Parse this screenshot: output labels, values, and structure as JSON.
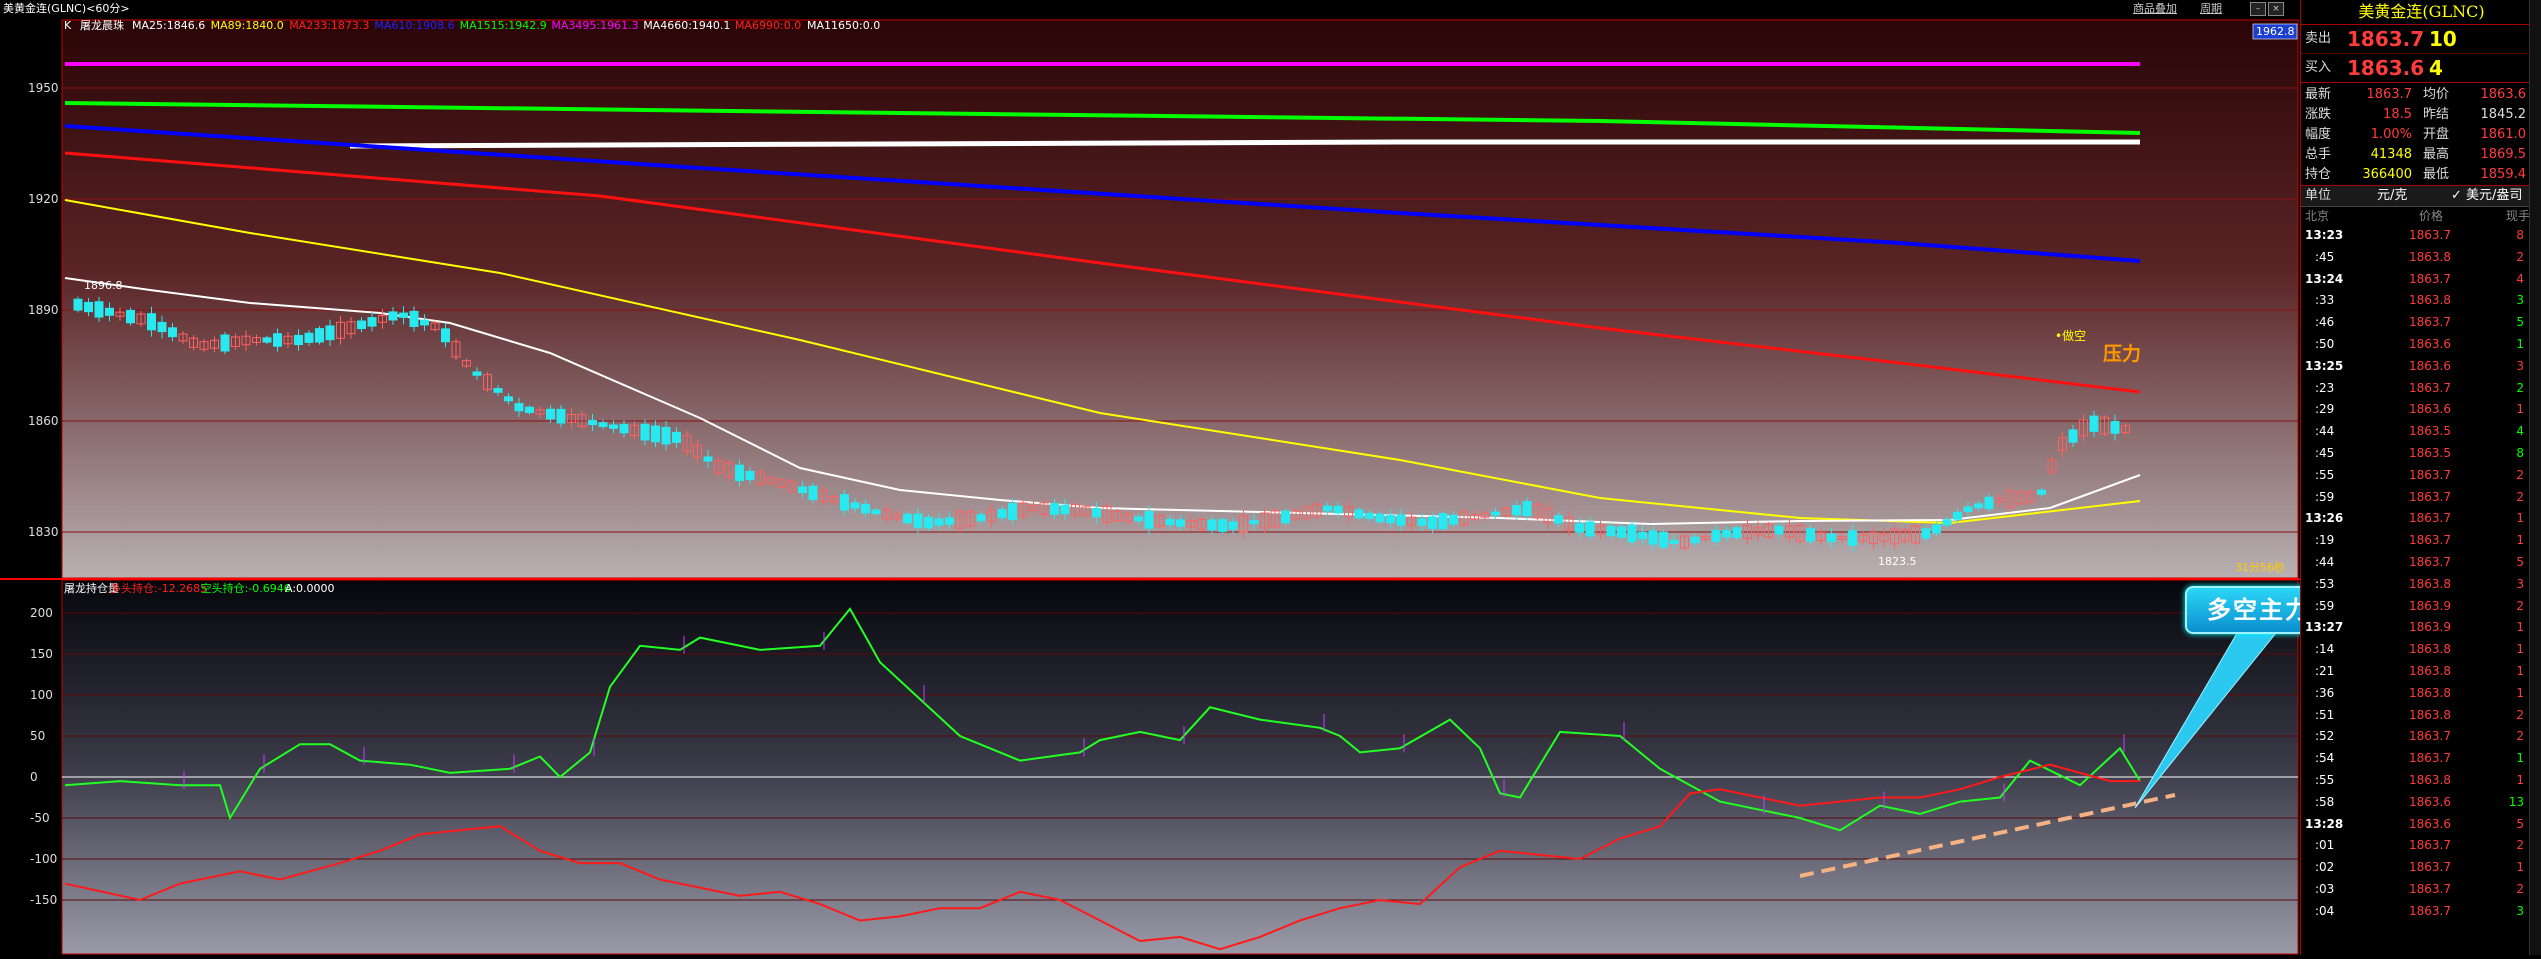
{
  "window": {
    "title": "美黄金连(GLNC)<60分>",
    "menu": [
      "商品叠加",
      "周期"
    ]
  },
  "main_chart": {
    "indicator_label": "K",
    "indicator_name": "屠龙晨珠",
    "ma_legend": [
      {
        "text": "MA25:1846.6",
        "color": "#ffffff"
      },
      {
        "text": "MA89:1840.0",
        "color": "#ffff00"
      },
      {
        "text": "MA233:1873.3",
        "color": "#ff2020"
      },
      {
        "text": "MA610:1908.6",
        "color": "#2222ff"
      },
      {
        "text": "MA1515:1942.9",
        "color": "#00ff00"
      },
      {
        "text": "MA3495:1961.3",
        "color": "#ff00ff"
      },
      {
        "text": "MA4660:1940.1",
        "color": "#ffffff"
      },
      {
        "text": "MA6990:0.0",
        "color": "#ff2020"
      },
      {
        "text": "MA11650:0.0",
        "color": "#ffffff"
      }
    ],
    "price_badge": "1962.8",
    "y_ticks": [
      "1950",
      "1920",
      "1890",
      "1860",
      "1830"
    ],
    "high_label": "1896.8",
    "low_label": "1823.5",
    "annotation_small": "•做空",
    "annotation_pressure": "压力",
    "countdown": "31分56秒"
  },
  "sub_chart": {
    "title": "屠龙持仓量",
    "legend": [
      {
        "text": "多头持仓:-12.2685",
        "color": "#ff2020"
      },
      {
        "text": "空头持仓:-0.6946",
        "color": "#00ff00"
      },
      {
        "text": "A:0.0000",
        "color": "#ffffff"
      }
    ],
    "y_ticks": [
      "200",
      "150",
      "100",
      "50",
      "0",
      "-50",
      "-100",
      "-150"
    ],
    "callout": "多空主力都有增仓动作"
  },
  "panel": {
    "title": "美黄金连(GLNC)",
    "sell": {
      "label": "卖出",
      "price": "1863.7",
      "volume": "10"
    },
    "buy": {
      "label": "买入",
      "price": "1863.6",
      "volume": "4"
    },
    "stats": [
      {
        "l1": "最新",
        "v1": "1863.7",
        "c1": "#ff3c3c",
        "l2": "均价",
        "v2": "1863.6",
        "c2": "#ff3c3c"
      },
      {
        "l1": "涨跌",
        "v1": "18.5",
        "c1": "#ff3c3c",
        "l2": "昨结",
        "v2": "1845.2",
        "c2": "#dddddd"
      },
      {
        "l1": "幅度",
        "v1": "1.00%",
        "c1": "#ff3c3c",
        "l2": "开盘",
        "v2": "1861.0",
        "c2": "#ff3c3c"
      },
      {
        "l1": "总手",
        "v1": "41348",
        "c1": "#ffff00",
        "l2": "最高",
        "v2": "1869.5",
        "c2": "#ff3c3c"
      },
      {
        "l1": "持仓",
        "v1": "366400",
        "c1": "#ffff00",
        "l2": "最低",
        "v2": "1859.4",
        "c2": "#ff3c3c"
      }
    ],
    "unit": {
      "label": "单位",
      "currency": "元/克",
      "usd": "✓ 美元/盎司"
    },
    "header": {
      "time": "北京",
      "price": "价格",
      "vol": "现手"
    },
    "ticks": [
      {
        "t": "13:23",
        "p": "1863.7",
        "v": "8",
        "pc": "#ff3c3c",
        "vc": "#ff3c3c",
        "bold": true
      },
      {
        "t": ":45",
        "p": "1863.8",
        "v": "2",
        "pc": "#ff3c3c",
        "vc": "#ff3c3c"
      },
      {
        "t": "13:24",
        "p": "1863.7",
        "v": "4",
        "pc": "#ff3c3c",
        "vc": "#ff3c3c",
        "bold": true
      },
      {
        "t": ":33",
        "p": "1863.8",
        "v": "3",
        "pc": "#ff3c3c",
        "vc": "#00ff00"
      },
      {
        "t": ":46",
        "p": "1863.7",
        "v": "5",
        "pc": "#ff3c3c",
        "vc": "#00ff00"
      },
      {
        "t": ":50",
        "p": "1863.6",
        "v": "1",
        "pc": "#ff3c3c",
        "vc": "#00ff00"
      },
      {
        "t": "13:25",
        "p": "1863.6",
        "v": "3",
        "pc": "#ff3c3c",
        "vc": "#ff3c3c",
        "bold": true
      },
      {
        "t": ":23",
        "p": "1863.7",
        "v": "2",
        "pc": "#ff3c3c",
        "vc": "#00ff00"
      },
      {
        "t": ":29",
        "p": "1863.6",
        "v": "1",
        "pc": "#ff3c3c",
        "vc": "#ff3c3c"
      },
      {
        "t": ":44",
        "p": "1863.5",
        "v": "4",
        "pc": "#ff3c3c",
        "vc": "#00ff00"
      },
      {
        "t": ":45",
        "p": "1863.5",
        "v": "8",
        "pc": "#ff3c3c",
        "vc": "#00ff00"
      },
      {
        "t": ":55",
        "p": "1863.7",
        "v": "2",
        "pc": "#ff3c3c",
        "vc": "#ff3c3c"
      },
      {
        "t": ":59",
        "p": "1863.7",
        "v": "2",
        "pc": "#ff3c3c",
        "vc": "#ff3c3c"
      },
      {
        "t": "13:26",
        "p": "1863.7",
        "v": "1",
        "pc": "#ff3c3c",
        "vc": "#ff3c3c",
        "bold": true
      },
      {
        "t": ":19",
        "p": "1863.7",
        "v": "1",
        "pc": "#ff3c3c",
        "vc": "#ff3c3c"
      },
      {
        "t": ":44",
        "p": "1863.7",
        "v": "5",
        "pc": "#ff3c3c",
        "vc": "#ff3c3c"
      },
      {
        "t": ":53",
        "p": "1863.8",
        "v": "3",
        "pc": "#ff3c3c",
        "vc": "#ff3c3c"
      },
      {
        "t": ":59",
        "p": "1863.9",
        "v": "2",
        "pc": "#ff3c3c",
        "vc": "#ff3c3c"
      },
      {
        "t": "13:27",
        "p": "1863.9",
        "v": "1",
        "pc": "#ff3c3c",
        "vc": "#ff3c3c",
        "bold": true
      },
      {
        "t": ":14",
        "p": "1863.8",
        "v": "1",
        "pc": "#ff3c3c",
        "vc": "#ff3c3c"
      },
      {
        "t": ":21",
        "p": "1863.8",
        "v": "1",
        "pc": "#ff3c3c",
        "vc": "#ff3c3c"
      },
      {
        "t": ":36",
        "p": "1863.8",
        "v": "1",
        "pc": "#ff3c3c",
        "vc": "#ff3c3c"
      },
      {
        "t": ":51",
        "p": "1863.8",
        "v": "2",
        "pc": "#ff3c3c",
        "vc": "#ff3c3c"
      },
      {
        "t": ":52",
        "p": "1863.7",
        "v": "2",
        "pc": "#ff3c3c",
        "vc": "#ff3c3c"
      },
      {
        "t": ":54",
        "p": "1863.7",
        "v": "1",
        "pc": "#ff3c3c",
        "vc": "#00ff00"
      },
      {
        "t": ":55",
        "p": "1863.8",
        "v": "1",
        "pc": "#ff3c3c",
        "vc": "#ff3c3c"
      },
      {
        "t": ":58",
        "p": "1863.6",
        "v": "13",
        "pc": "#ff3c3c",
        "vc": "#00ff00"
      },
      {
        "t": "13:28",
        "p": "1863.6",
        "v": "5",
        "pc": "#ff3c3c",
        "vc": "#ff3c3c",
        "bold": true
      },
      {
        "t": ":01",
        "p": "1863.7",
        "v": "2",
        "pc": "#ff3c3c",
        "vc": "#ff3c3c"
      },
      {
        "t": ":02",
        "p": "1863.7",
        "v": "1",
        "pc": "#ff3c3c",
        "vc": "#ff3c3c"
      },
      {
        "t": ":03",
        "p": "1863.7",
        "v": "2",
        "pc": "#ff3c3c",
        "vc": "#ff3c3c"
      },
      {
        "t": ":04",
        "p": "1863.7",
        "v": "3",
        "pc": "#ff3c3c",
        "vc": "#00ff00"
      }
    ]
  }
}
